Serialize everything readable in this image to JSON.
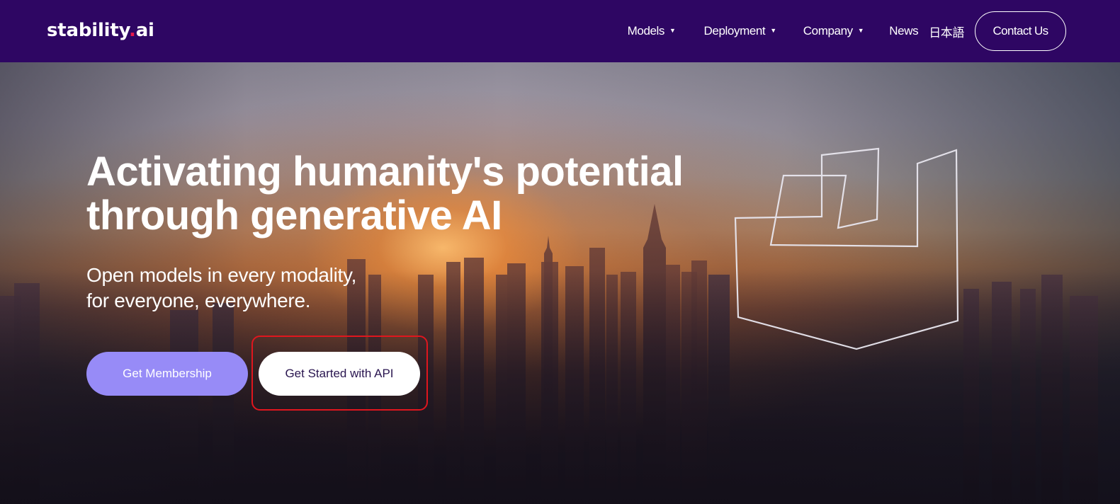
{
  "nav": {
    "logo": {
      "text_main": "stability",
      "text_dot": ".",
      "text_suffix": "ai"
    },
    "items": [
      {
        "label": "Models",
        "has_dropdown": true,
        "caret": "▼"
      },
      {
        "label": "Deployment",
        "has_dropdown": true,
        "caret": "▼"
      },
      {
        "label": "Company",
        "has_dropdown": true,
        "caret": "▼"
      },
      {
        "label": "News",
        "has_dropdown": false
      },
      {
        "label": "日本語",
        "has_dropdown": false
      }
    ],
    "contact_label": "Contact Us"
  },
  "hero": {
    "headline_line1": "Activating humanity's potential",
    "headline_line2": "through generative AI",
    "subline_line1": "Open models in every modality,",
    "subline_line2": "for everyone, everywhere.",
    "primary_button": "Get Membership",
    "secondary_button": "Get Started with API",
    "background_image": "sunset-city-skyline",
    "brand_mark_icon": "stability-outline-mark-icon"
  },
  "colors": {
    "nav_bg": "#2e0663",
    "primary_button_bg": "#978bf7",
    "secondary_button_text": "#2a1650",
    "logo_dot": "#e6194b",
    "highlight": "#e0161e"
  }
}
